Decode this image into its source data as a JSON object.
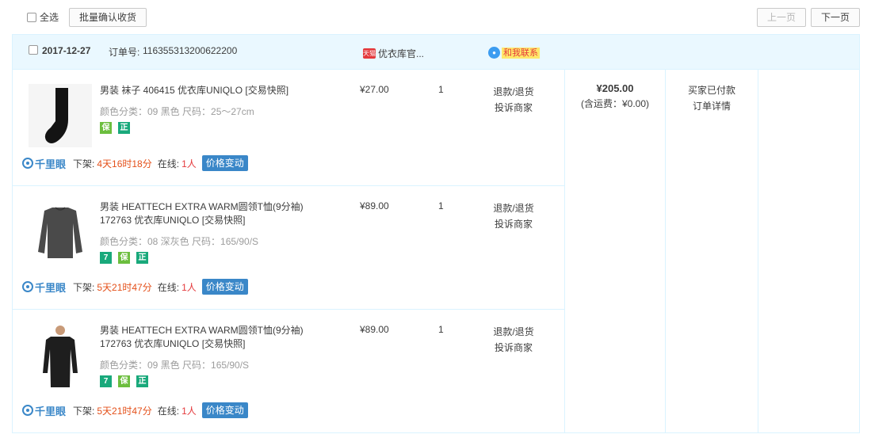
{
  "toolbar": {
    "select_all_label": "全选",
    "batch_confirm_label": "批量确认收货",
    "prev_label": "上一页",
    "next_label": "下一页"
  },
  "order": {
    "date": "2017-12-27",
    "order_no_label": "订单号:",
    "order_no": "116355313200622200",
    "shop_name": "优衣库官...",
    "shop_icon_text": "天猫",
    "contact_label": "和我联系",
    "total": "¥205.00",
    "shipping": "(含运费：¥0.00)",
    "status": "买家已付款",
    "detail_link": "订单详情",
    "items": [
      {
        "title": "男装 袜子 406415 优衣库UNIQLO",
        "snapshot": "[交易快照]",
        "attrs": "颜色分类：09 黑色  尺码：25～27cm",
        "price": "¥27.00",
        "qty": "1",
        "action1": "退款/退货",
        "action2": "投诉商家",
        "qly_brand": "千里眼",
        "offshelf_label": "下架:",
        "offshelf_time": "4天16时18分",
        "online_label": "在线:",
        "online_count": "1人",
        "price_change_label": "价格变动"
      },
      {
        "title": "男装 HEATTECH EXTRA WARM圆领T恤(9分袖) 172763 优衣库UNIQLO",
        "snapshot": "[交易快照]",
        "attrs": "颜色分类：08 深灰色  尺码：165/90/S",
        "price": "¥89.00",
        "qty": "1",
        "action1": "退款/退货",
        "action2": "投诉商家",
        "qly_brand": "千里眼",
        "offshelf_label": "下架:",
        "offshelf_time": "5天21时47分",
        "online_label": "在线:",
        "online_count": "1人",
        "price_change_label": "价格变动"
      },
      {
        "title": "男装 HEATTECH EXTRA WARM圆领T恤(9分袖) 172763 优衣库UNIQLO",
        "snapshot": "[交易快照]",
        "attrs": "颜色分类：09 黑色  尺码：165/90/S",
        "price": "¥89.00",
        "qty": "1",
        "action1": "退款/退货",
        "action2": "投诉商家",
        "qly_brand": "千里眼",
        "offshelf_label": "下架:",
        "offshelf_time": "5天21时47分",
        "online_label": "在线:",
        "online_count": "1人",
        "price_change_label": "价格变动"
      }
    ]
  },
  "badges": {
    "seven": "7",
    "guard": "保",
    "zheng": "正"
  },
  "colors": {
    "header_bg": "#eaf8ff",
    "border": "#daf3ff",
    "accent_blue": "#3a87c8",
    "time_red": "#e4501a",
    "badge_green": "#19a97b"
  }
}
